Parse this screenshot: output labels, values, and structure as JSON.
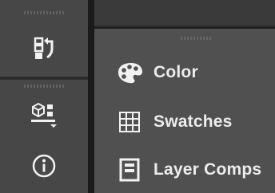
{
  "dock": {
    "buttons": [
      {
        "name": "history",
        "icon": "history-icon"
      },
      {
        "name": "3d",
        "icon": "3d-cube-icon"
      },
      {
        "name": "info",
        "icon": "info-icon"
      }
    ]
  },
  "panel": {
    "items": [
      {
        "label": "Color",
        "icon": "palette-icon"
      },
      {
        "label": "Swatches",
        "icon": "swatches-grid-icon"
      },
      {
        "label": "Layer Comps",
        "icon": "layer-comps-icon"
      }
    ]
  },
  "colors": {
    "dock_bg": "#474747",
    "panel_bg": "#505050",
    "icon": "#f2f2f2",
    "text": "#ececec"
  }
}
